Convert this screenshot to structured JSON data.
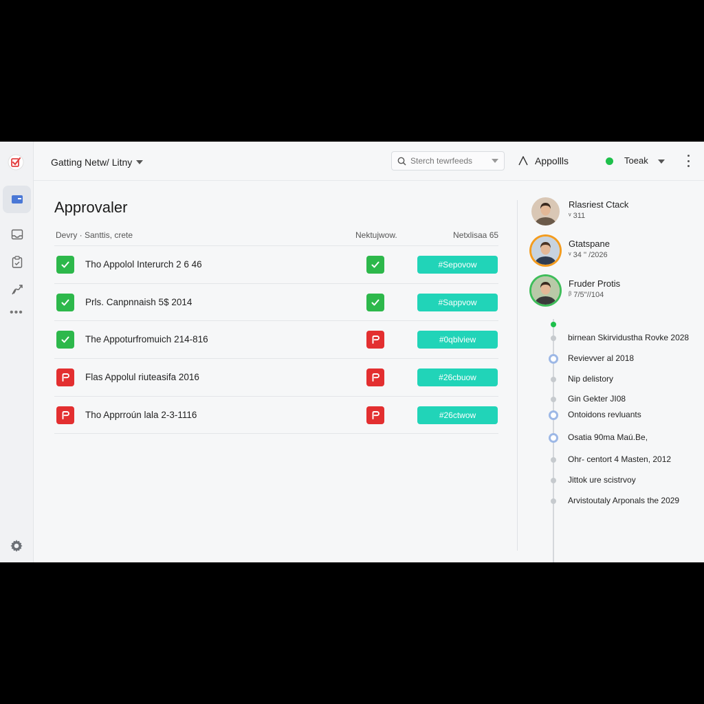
{
  "header": {
    "page_menu": "Gatting Netw/ Litny",
    "search_placeholder": "Sterch tewrfeeds",
    "apps_label": "Appollls",
    "user_name": "Toeak"
  },
  "main": {
    "title": "Approvaler",
    "columns": [
      "Devry · Santtis, crete",
      "Nektujwow.",
      "Netxlisaa 65"
    ],
    "rows": [
      {
        "status": "ok",
        "title": "Tho Appolol Interurch 2 6 46",
        "mid": "ok",
        "tag": "#Sepovow"
      },
      {
        "status": "ok",
        "title": "Prls. Canpnnaish 5$ 2014",
        "mid": "ok",
        "tag": "#Sappvow"
      },
      {
        "status": "ok",
        "title": "The Appoturfromuich 214-816",
        "mid": "flag",
        "tag": "#0qblview"
      },
      {
        "status": "flag",
        "title": "Flas Appolul riuteasifa 2016",
        "mid": "flag",
        "tag": "#26cbuow"
      },
      {
        "status": "flag",
        "title": "Tho Apprroún lala 2-3-1116",
        "mid": "flag",
        "tag": "#26ctwow"
      }
    ]
  },
  "panel": {
    "people": [
      {
        "name": "Rlasriest Ctack",
        "sub": "ᵛ 311",
        "ring": "none"
      },
      {
        "name": "Gtatspane",
        "sub": "ᵛ 34 '' /2026",
        "ring": "orange"
      },
      {
        "name": "Fruder Protis",
        "sub": "ᵝ 7/5''//104",
        "ring": "green"
      }
    ],
    "timeline": [
      {
        "text": "",
        "dot": "green"
      },
      {
        "text": "birnean Skirvidustha Rovke 2028",
        "dot": "gray"
      },
      {
        "text": "Revievver al 2018",
        "dot": "blue"
      },
      {
        "text": "Nip delistory",
        "dot": "gray"
      },
      {
        "text": "Gin Gekter JI08",
        "dot": "gray"
      },
      {
        "text": "Ontoidons revluants",
        "dot": "blue"
      },
      {
        "text": "Osatia 90ma Maú.Be,",
        "dot": "blue"
      },
      {
        "text": "Ohr- centort 4 Masten, 2012",
        "dot": "gray"
      },
      {
        "text": "Jittok ure scistrvoy",
        "dot": "gray"
      },
      {
        "text": "Arvistoutaly Arponals the 2029",
        "dot": "gray"
      }
    ]
  },
  "colors": {
    "accent_teal": "#21d4b8",
    "ok_green": "#2db84b",
    "flag_red": "#e32f30",
    "online_green": "#1ec04b"
  }
}
